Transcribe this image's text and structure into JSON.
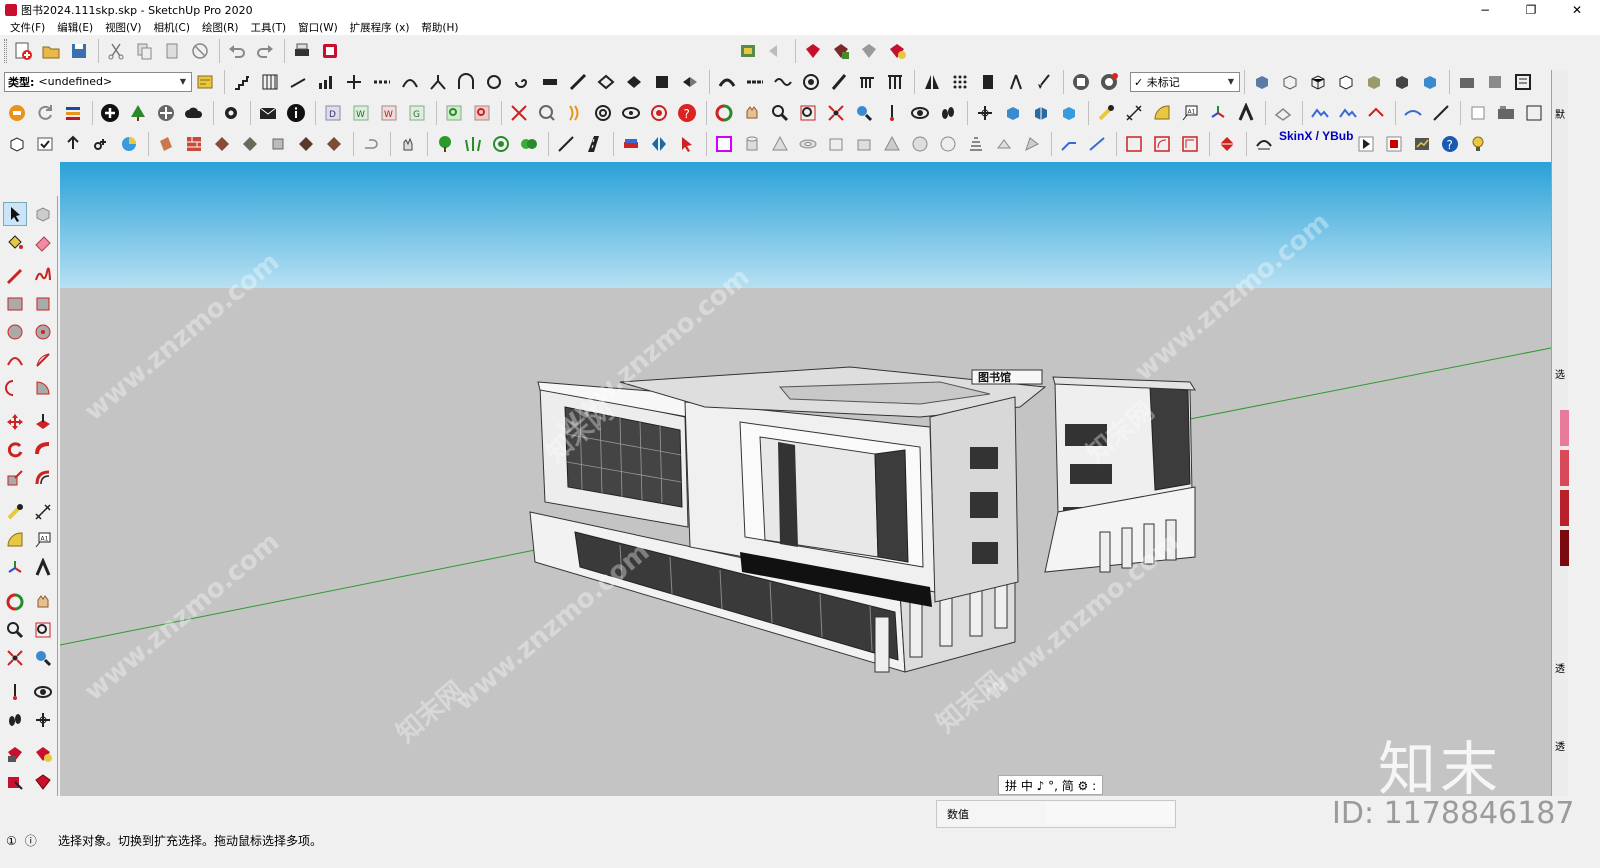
{
  "window": {
    "title": "图书2024.111skp.skp - SketchUp Pro 2020",
    "controls": {
      "minimize": "−",
      "maximize": "❐",
      "close": "✕"
    }
  },
  "menubar": {
    "items": [
      "文件(F)",
      "编辑(E)",
      "视图(V)",
      "相机(C)",
      "绘图(R)",
      "工具(T)",
      "窗口(W)",
      "扩展程序 (x)",
      "帮助(H)"
    ]
  },
  "toolbar": {
    "type_label": "类型:",
    "type_value": "<undefined>",
    "tag_value": "✓ 未标记",
    "skin_label": "SkinX / YBub"
  },
  "viewport": {
    "sky_color": "#2aa1d8",
    "ground_color": "#c4c4c4",
    "axis_color": "#2e9a2e",
    "watermark_text": "www.znzmo.com",
    "watermark_cn": "知末网",
    "brand_mark": "知末",
    "building_sign": "图书馆",
    "ime_text": "拼 中 ♪ °, 简 ⚙ :"
  },
  "statusbar": {
    "hint": "选择对象。切换到扩充选择。拖动鼠标选择多项。",
    "measure_label": "数值",
    "id_text": "ID: 1178846187"
  },
  "tray": {
    "labels": [
      "默",
      "选",
      "透",
      "透"
    ]
  }
}
